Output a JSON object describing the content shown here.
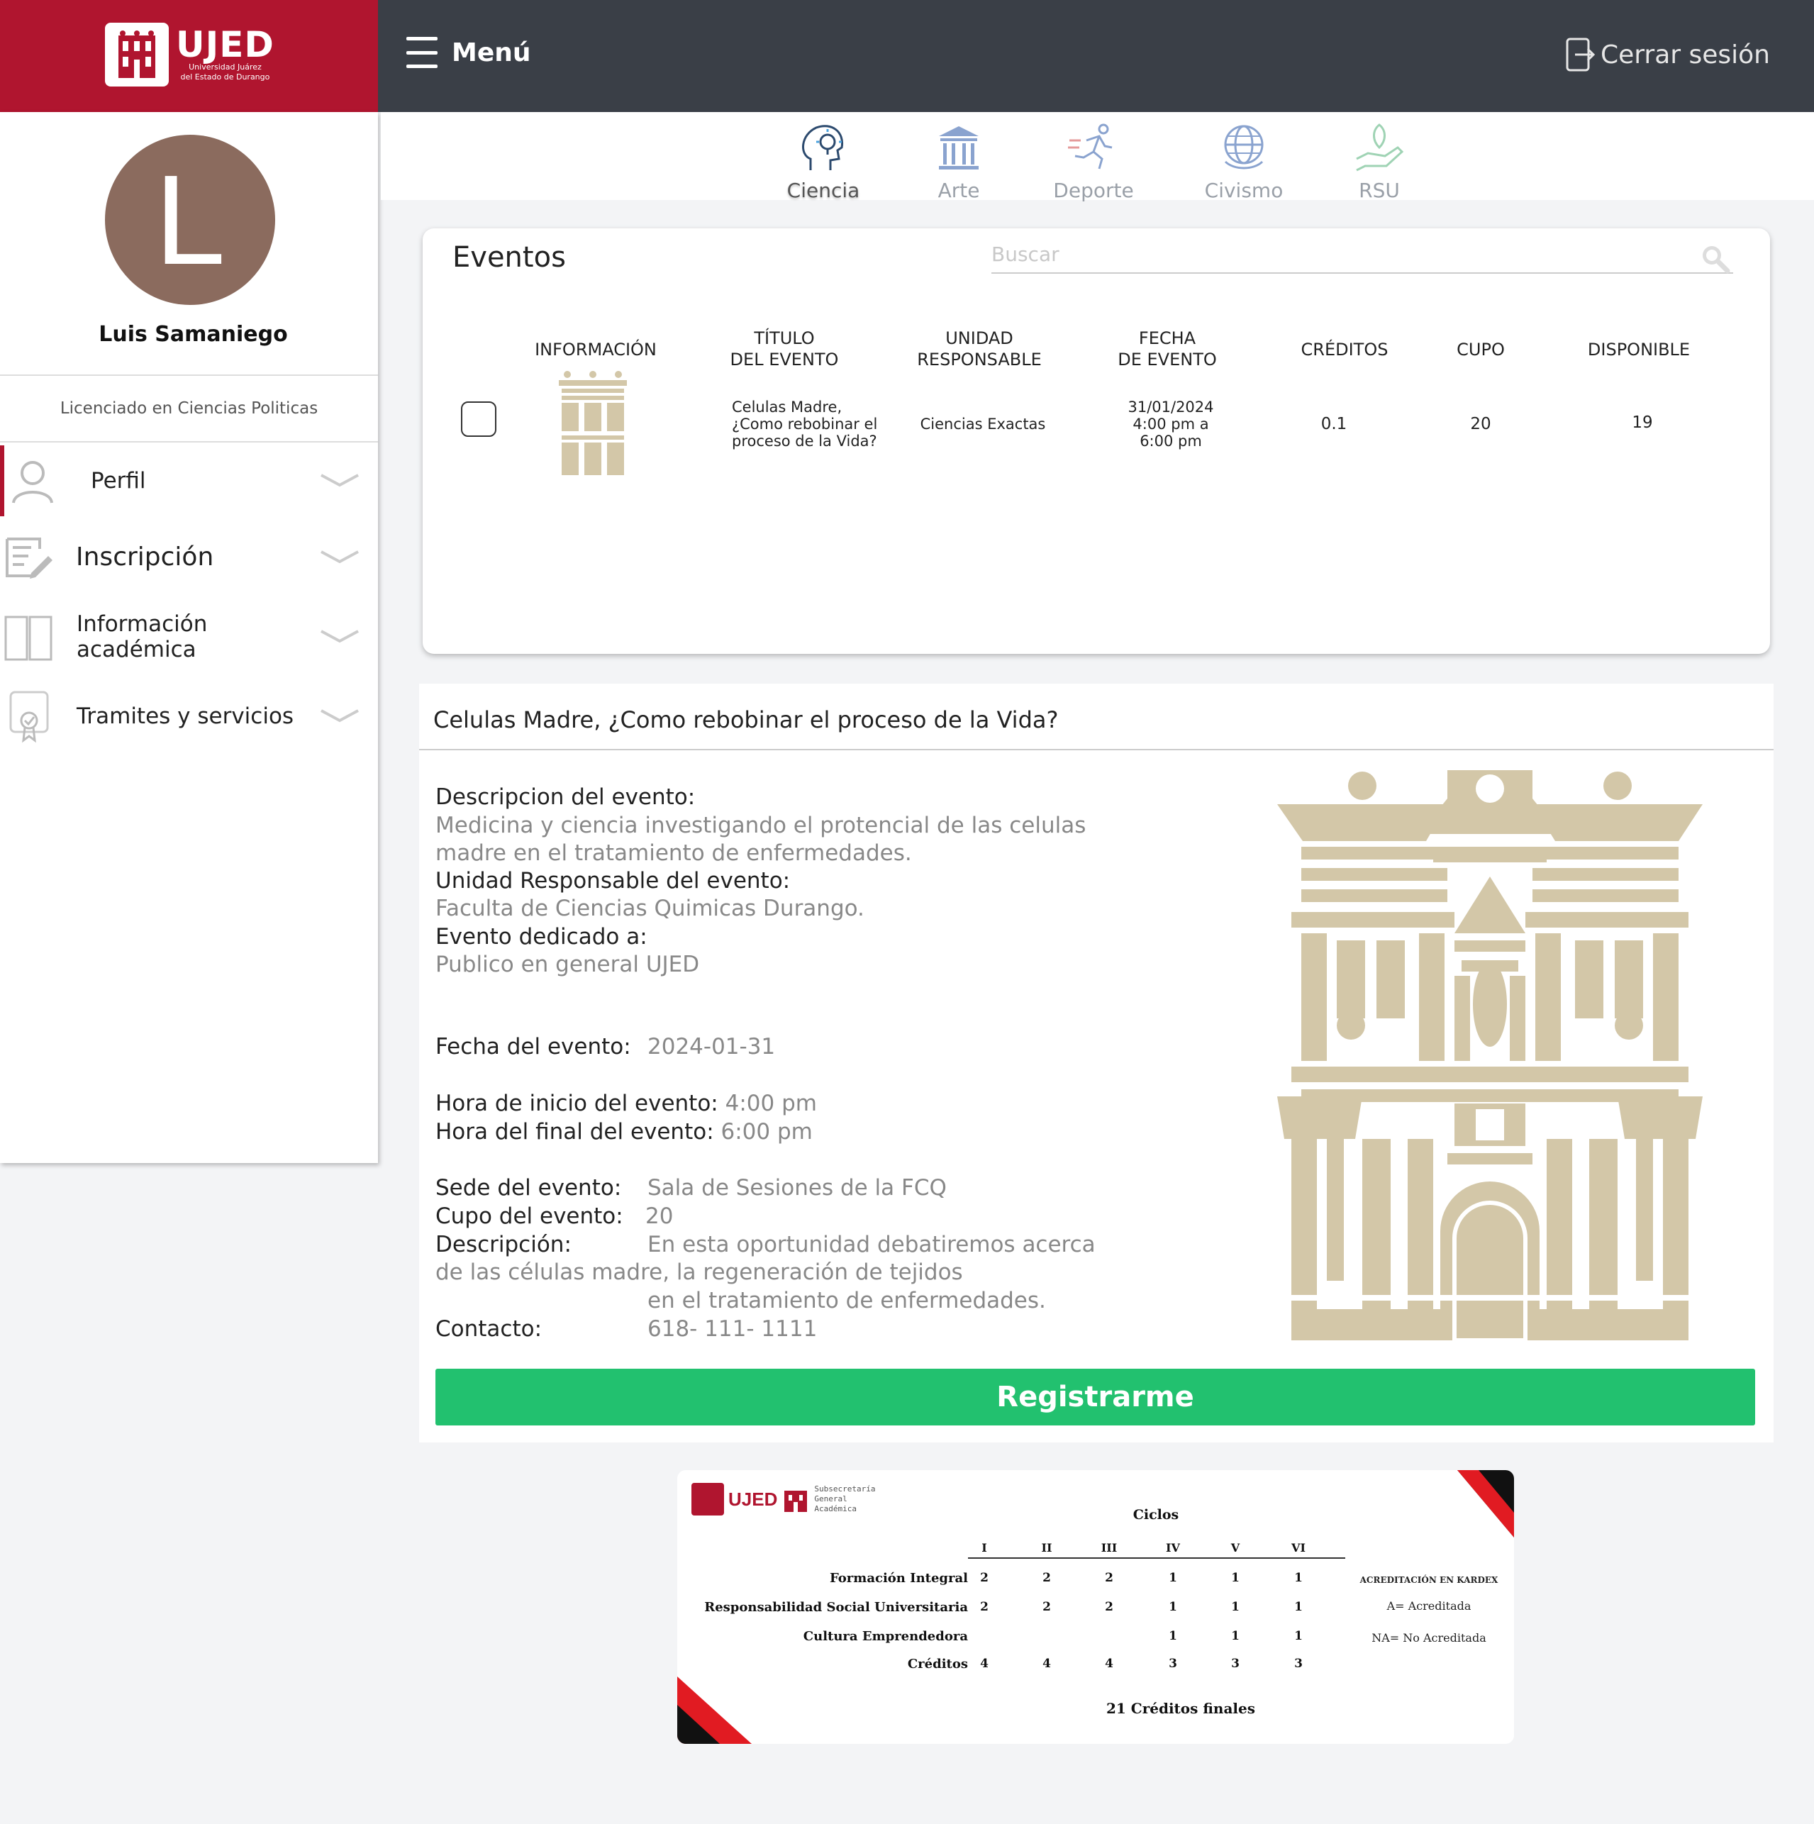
{
  "brand": {
    "name": "UJED",
    "subtitle_line1": "Universidad Juárez",
    "subtitle_line2": "del Estado de Durango"
  },
  "topbar": {
    "menu_label": "Menú",
    "logout_label": "Cerrar sesión"
  },
  "user": {
    "initial": "L",
    "name": "Luis Samaniego",
    "degree": "Licenciado en Ciencias Politicas"
  },
  "sidebar": {
    "items": [
      {
        "label": "Perfil"
      },
      {
        "label": "Inscripción"
      },
      {
        "label_line1": "Información",
        "label_line2": "académica"
      },
      {
        "label": "Tramites y servicios"
      }
    ]
  },
  "categories": [
    "Ciencia",
    "Arte",
    "Deporte",
    "Civismo",
    "RSU"
  ],
  "events": {
    "title": "Eventos",
    "search_placeholder": "Buscar",
    "headers": {
      "info": "INFORMACIÓN",
      "title_l1": "TÍTULO",
      "title_l2": "DEL EVENTO",
      "unit_l1": "UNIDAD",
      "unit_l2": "RESPONSABLE",
      "date_l1": "FECHA",
      "date_l2": "DE EVENTO",
      "credits": "CRÉDITOS",
      "quota": "CUPO",
      "available": "DISPONIBLE"
    },
    "row": {
      "title_l1": "Celulas Madre,",
      "title_l2": "¿Como rebobinar el",
      "title_l3": "proceso de la Vida?",
      "unit": "Ciencias Exactas",
      "date_l1": "31/01/2024",
      "date_l2": "4:00 pm a",
      "date_l3": "6:00 pm",
      "credits": "0.1",
      "quota": "20",
      "available": "19"
    }
  },
  "detail": {
    "heading": "Celulas Madre, ¿Como rebobinar el proceso de la Vida?",
    "desc_label": "Descripcion del evento:",
    "desc_l1": "Medicina y ciencia investigando el protencial de las celulas",
    "desc_l2": "madre en el tratamiento de enfermedades.",
    "unit_label": "Unidad Responsable del evento:",
    "unit_value": "Faculta de Ciencias Quimicas Durango.",
    "audience_label": "Evento dedicado a:",
    "audience_value": "Publico en general UJED",
    "date_label": "Fecha del evento:",
    "date_value": "2024-01-31",
    "start_label": "Hora de inicio del evento:",
    "start_value": "4:00 pm",
    "end_label": "Hora del final del evento:",
    "end_value": "6:00 pm",
    "venue_label": "Sede del evento:",
    "venue_value": "Sala de Sesiones de la FCQ",
    "quota_label": "Cupo del evento:",
    "quota_value": "20",
    "description_label": "Descripción:",
    "description_l1": "En esta oportunidad debatiremos acerca",
    "description_l2": "de las células madre, la regeneración de tejidos",
    "description_l3": "en el tratamiento de enfermedades.",
    "contact_label": "Contacto:",
    "contact_value": "618- 111- 1111",
    "register_label": "Registrarme"
  },
  "credits_card": {
    "brand": "UJED",
    "sub_l1": "Subsecretaría",
    "sub_l2": "General",
    "sub_l3": "Académica",
    "title": "Ciclos",
    "cycles": [
      "I",
      "II",
      "III",
      "IV",
      "V",
      "VI"
    ],
    "rows": [
      {
        "label": "Formación Integral",
        "values": [
          "2",
          "2",
          "2",
          "1",
          "1",
          "1"
        ]
      },
      {
        "label": "Responsabilidad Social Universitaria",
        "values": [
          "2",
          "2",
          "2",
          "1",
          "1",
          "1"
        ]
      },
      {
        "label": "Cultura Emprendedora",
        "values": [
          "",
          "",
          "",
          "1",
          "1",
          "1"
        ]
      },
      {
        "label": "Créditos",
        "values": [
          "4",
          "4",
          "4",
          "3",
          "3",
          "3"
        ]
      }
    ],
    "total": "21 Créditos finales",
    "legend_title": "ACREDITACIÓN EN KARDEX",
    "legend_a": "A= Acreditada",
    "legend_na": "NA= No Acreditada"
  },
  "colors": {
    "brand_red": "#b0152f",
    "topbar": "#3a3f47",
    "register_green": "#22c16f",
    "building_beige": "#d3c7a8"
  }
}
